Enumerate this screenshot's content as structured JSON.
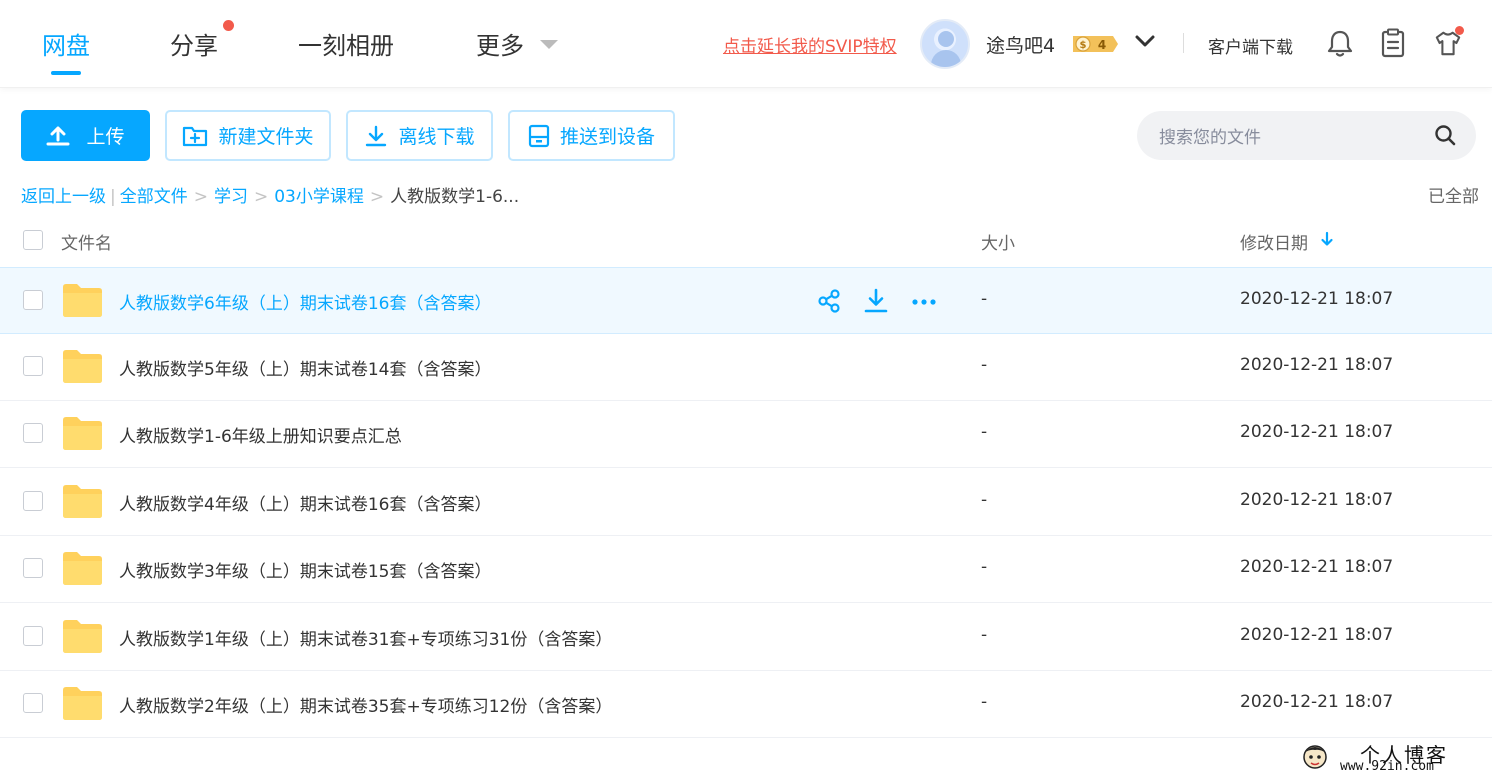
{
  "nav": {
    "tabs": [
      "网盘",
      "分享",
      "一刻相册",
      "更多"
    ],
    "active_index": 0
  },
  "header": {
    "svip_link": "点击延长我的SVIP特权",
    "username": "途鸟吧4",
    "vip_level": "4",
    "client_download": "客户端下载"
  },
  "toolbar": {
    "upload": "上传",
    "new_folder": "新建文件夹",
    "offline_download": "离线下载",
    "push_to_device": "推送到设备"
  },
  "search": {
    "placeholder": "搜索您的文件"
  },
  "breadcrumb": {
    "back": "返回上一级",
    "all_files": "全部文件",
    "level1": "学习",
    "level2": "03小学课程",
    "current": "人教版数学1-6...",
    "loaded_all": "已全部"
  },
  "table": {
    "headers": {
      "name": "文件名",
      "size": "大小",
      "date": "修改日期"
    },
    "rows": [
      {
        "name": "人教版数学6年级（上）期末试卷16套（含答案）",
        "size": "-",
        "date": "2020-12-21 18:07",
        "hovered": true
      },
      {
        "name": "人教版数学5年级（上）期末试卷14套（含答案）",
        "size": "-",
        "date": "2020-12-21 18:07"
      },
      {
        "name": "人教版数学1-6年级上册知识要点汇总",
        "size": "-",
        "date": "2020-12-21 18:07"
      },
      {
        "name": "人教版数学4年级（上）期末试卷16套（含答案）",
        "size": "-",
        "date": "2020-12-21 18:07"
      },
      {
        "name": "人教版数学3年级（上）期末试卷15套（含答案）",
        "size": "-",
        "date": "2020-12-21 18:07"
      },
      {
        "name": "人教版数学1年级（上）期末试卷31套+专项练习31份（含答案）",
        "size": "-",
        "date": "2020-12-21 18:07"
      },
      {
        "name": "人教版数学2年级（上）期末试卷35套+专项练习12份（含答案）",
        "size": "-",
        "date": "2020-12-21 18:07"
      }
    ]
  },
  "watermark": {
    "title": "个人博客",
    "url": "www.92in.com"
  },
  "colors": {
    "accent": "#06a7ff",
    "alert": "#f25a4b",
    "folder": "#ffd15c",
    "hover_row": "#f0f9ff"
  }
}
